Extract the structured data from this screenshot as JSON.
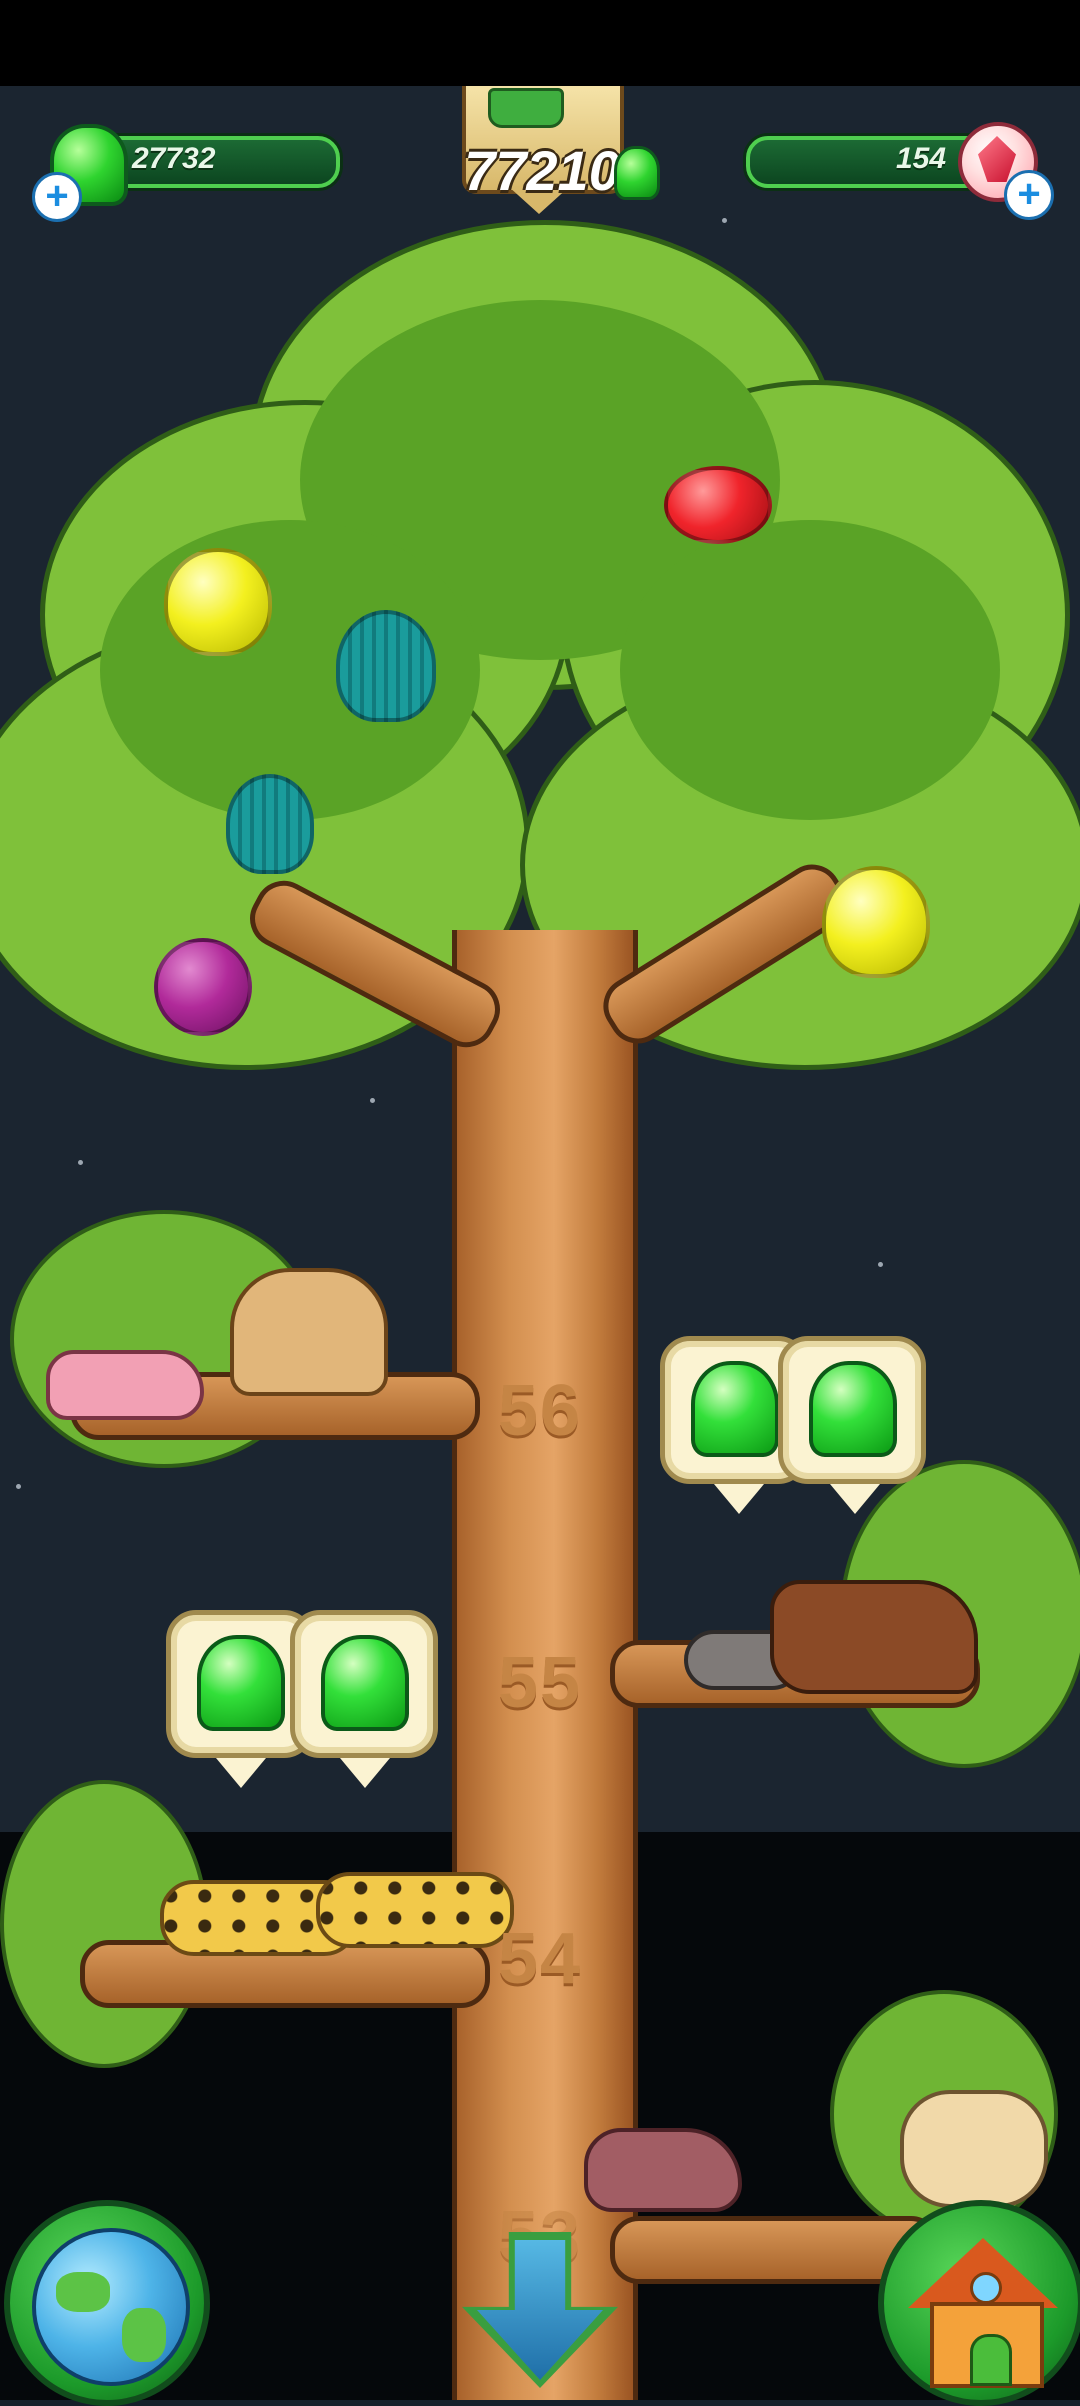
{
  "hud": {
    "left_counter": {
      "value": "27732",
      "icon": "green-gem-icon",
      "action_icon": "plus-icon"
    },
    "center_banner": {
      "value": "77210",
      "icon": "watering-can-icon",
      "currency_icon": "green-gem-icon"
    },
    "right_counter": {
      "value": "154",
      "icon": "ruby-crystal-icon",
      "action_icon": "plus-icon"
    }
  },
  "tree": {
    "levels": [
      {
        "number": "56",
        "animals": [
          "naked-mole-rat",
          "camel"
        ],
        "reward_bubbles": 2
      },
      {
        "number": "55",
        "animals": [
          "grey-cat",
          "ox"
        ],
        "reward_bubbles": 2
      },
      {
        "number": "54",
        "animals": [
          "cheetah",
          "cheetah"
        ],
        "reward_bubbles": 0
      },
      {
        "number": "53",
        "animals": [
          "aardvark",
          "lynx"
        ],
        "reward_bubbles": 0
      }
    ],
    "fruits": [
      "yellow",
      "teal",
      "red",
      "teal",
      "purple",
      "yellow"
    ]
  },
  "controls": {
    "left_button_icon": "globe-icon",
    "center_button_icon": "down-arrow-icon",
    "right_button_icon": "house-icon"
  },
  "colors": {
    "sky": "#1b2530",
    "leaf": "#7fc13a",
    "trunk": "#d38f4f",
    "gem": "#2fd42f",
    "ruby": "#c8102e"
  }
}
